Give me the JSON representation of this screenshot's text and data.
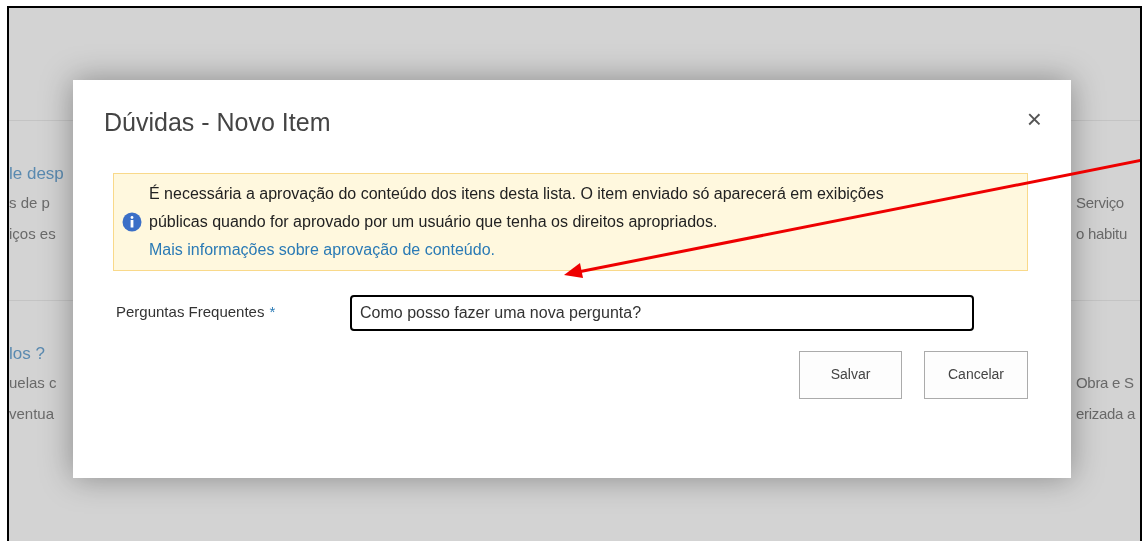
{
  "background": {
    "sections": [
      {
        "left": [
          {
            "text": "le desp",
            "kind": "link"
          },
          {
            "text": "s de p",
            "kind": "text"
          },
          {
            "text": "iços es",
            "kind": "text"
          }
        ],
        "right": [
          {
            "text": "Serviço",
            "kind": "text"
          },
          {
            "text": "o habitu",
            "kind": "text"
          }
        ]
      },
      {
        "left": [
          {
            "text": "los ?",
            "kind": "link"
          },
          {
            "text": "uelas c",
            "kind": "text"
          },
          {
            "text": "ventua",
            "kind": "text"
          }
        ],
        "right": [
          {
            "text": "Obra e S",
            "kind": "text"
          },
          {
            "text": "erizada a",
            "kind": "text"
          }
        ]
      }
    ]
  },
  "dialog": {
    "title": "Dúvidas - Novo Item",
    "close": "×",
    "notice": {
      "text": "É necessária a aprovação do conteúdo dos itens desta lista. O item enviado só aparecerá em exibições públicas quando for aprovado por um usuário que tenha os direitos apropriados.",
      "link": "Mais informações sobre aprovação de conteúdo."
    },
    "field": {
      "label": "Perguntas Frequentes",
      "required_mark": "*",
      "value": "Como posso fazer uma nova pergunta?"
    },
    "buttons": [
      "Salvar",
      "Cancelar"
    ]
  }
}
